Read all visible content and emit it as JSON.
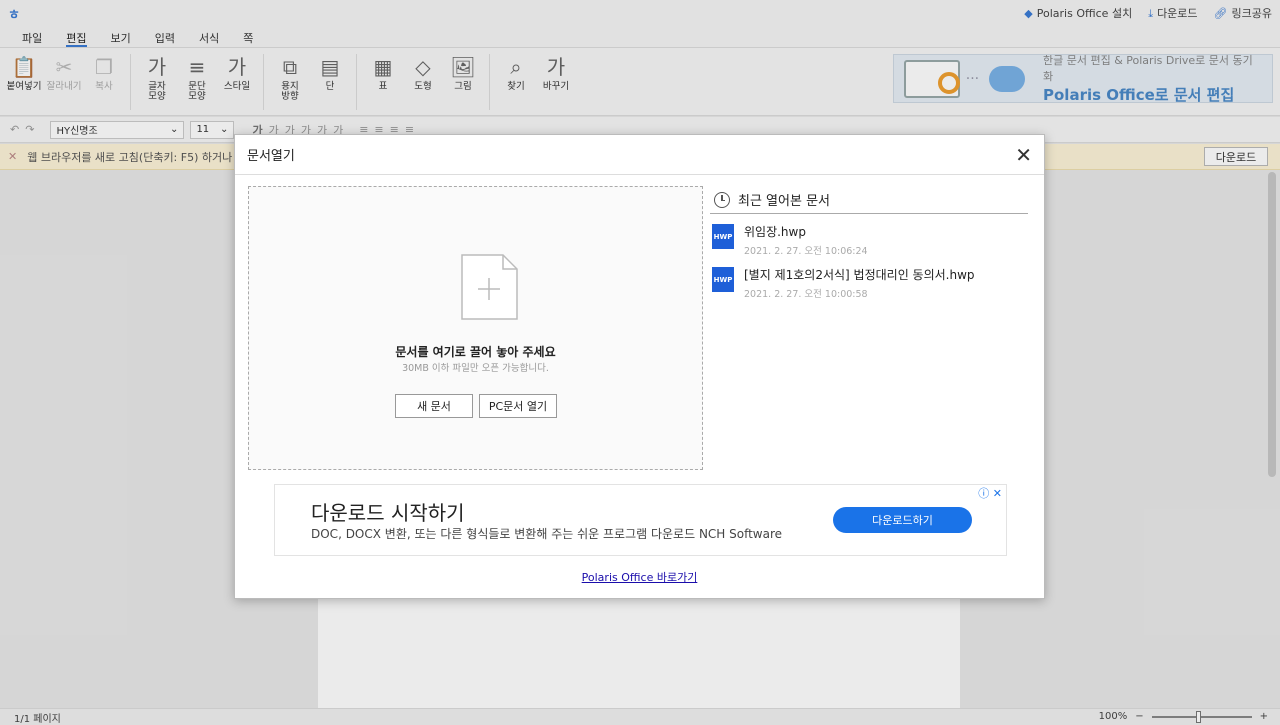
{
  "topbar": {
    "logo": "ㅎ",
    "links": [
      {
        "icon": "polaris-icon",
        "label": "Polaris Office 설치"
      },
      {
        "icon": "download-icon",
        "label": "다운로드"
      },
      {
        "icon": "link-icon",
        "label": "링크공유"
      }
    ]
  },
  "menu": {
    "tabs": [
      "파일",
      "편집",
      "보기",
      "입력",
      "서식",
      "쪽"
    ],
    "active": "편집"
  },
  "ribbon": {
    "buttons": [
      {
        "icon": "paste-icon",
        "glyph": "📋",
        "label": "붙여넣기",
        "disabled": false
      },
      {
        "icon": "cut-icon",
        "glyph": "✂",
        "label": "잘라내기",
        "disabled": true
      },
      {
        "icon": "copy-icon",
        "glyph": "❐",
        "label": "복사",
        "disabled": true
      },
      {
        "icon": "font-shape-icon",
        "glyph": "가",
        "label": "글자\n모양",
        "disabled": false
      },
      {
        "icon": "paragraph-icon",
        "glyph": "≡",
        "label": "문단\n모양",
        "disabled": false
      },
      {
        "icon": "style-icon",
        "glyph": "가",
        "label": "스타일",
        "disabled": false
      },
      {
        "icon": "paper-direction-icon",
        "glyph": "⧉",
        "label": "용지\n방향",
        "disabled": false
      },
      {
        "icon": "column-icon",
        "glyph": "▤",
        "label": "단",
        "disabled": false
      },
      {
        "icon": "table-icon",
        "glyph": "▦",
        "label": "표",
        "disabled": false
      },
      {
        "icon": "shape-icon",
        "glyph": "◇",
        "label": "도형",
        "disabled": false
      },
      {
        "icon": "picture-icon",
        "glyph": "🖼",
        "label": "그림",
        "disabled": false
      },
      {
        "icon": "find-icon",
        "glyph": "⌕",
        "label": "찾기",
        "disabled": false
      },
      {
        "icon": "replace-icon",
        "glyph": "가",
        "label": "바꾸기",
        "disabled": false
      }
    ]
  },
  "ad_banner": {
    "line1": "한글 문서 편집 & Polaris Drive로 문서 동기화",
    "line2": "Polaris Office로 문서 편집"
  },
  "format": {
    "font": "HY신명조",
    "size": "11"
  },
  "notice": {
    "text": "웹 브라우저를 새로 고침(단축키: F5) 하거나 닫",
    "button": "다운로드"
  },
  "status": {
    "pages": "1/1 페이지",
    "zoom": "100%"
  },
  "dialog": {
    "title": "문서열기",
    "drop_title": "문서를 여기로 끌어 놓아 주세요",
    "drop_sub": "30MB 이하 파일만 오픈 가능합니다.",
    "new_button": "새 문서",
    "pc_button": "PC문서 열기",
    "recent_title": "최근 열어본 문서",
    "recent": [
      {
        "name": "위임장.hwp",
        "date": "2021. 2. 27. 오전 10:06:24",
        "icon_text": "HWP"
      },
      {
        "name": "[별지 제1호의2서식] 법정대리인 동의서.hwp",
        "date": "2021. 2. 27. 오전 10:00:58",
        "icon_text": "HWP"
      }
    ],
    "ad": {
      "title": "다운로드 시작하기",
      "desc": "DOC, DOCX 변환, 또는 다른 형식들로 변환해 주는 쉬운 프로그램 다운로드 NCH Software",
      "button": "다운로드하기"
    },
    "link": "Polaris Office 바로가기"
  }
}
